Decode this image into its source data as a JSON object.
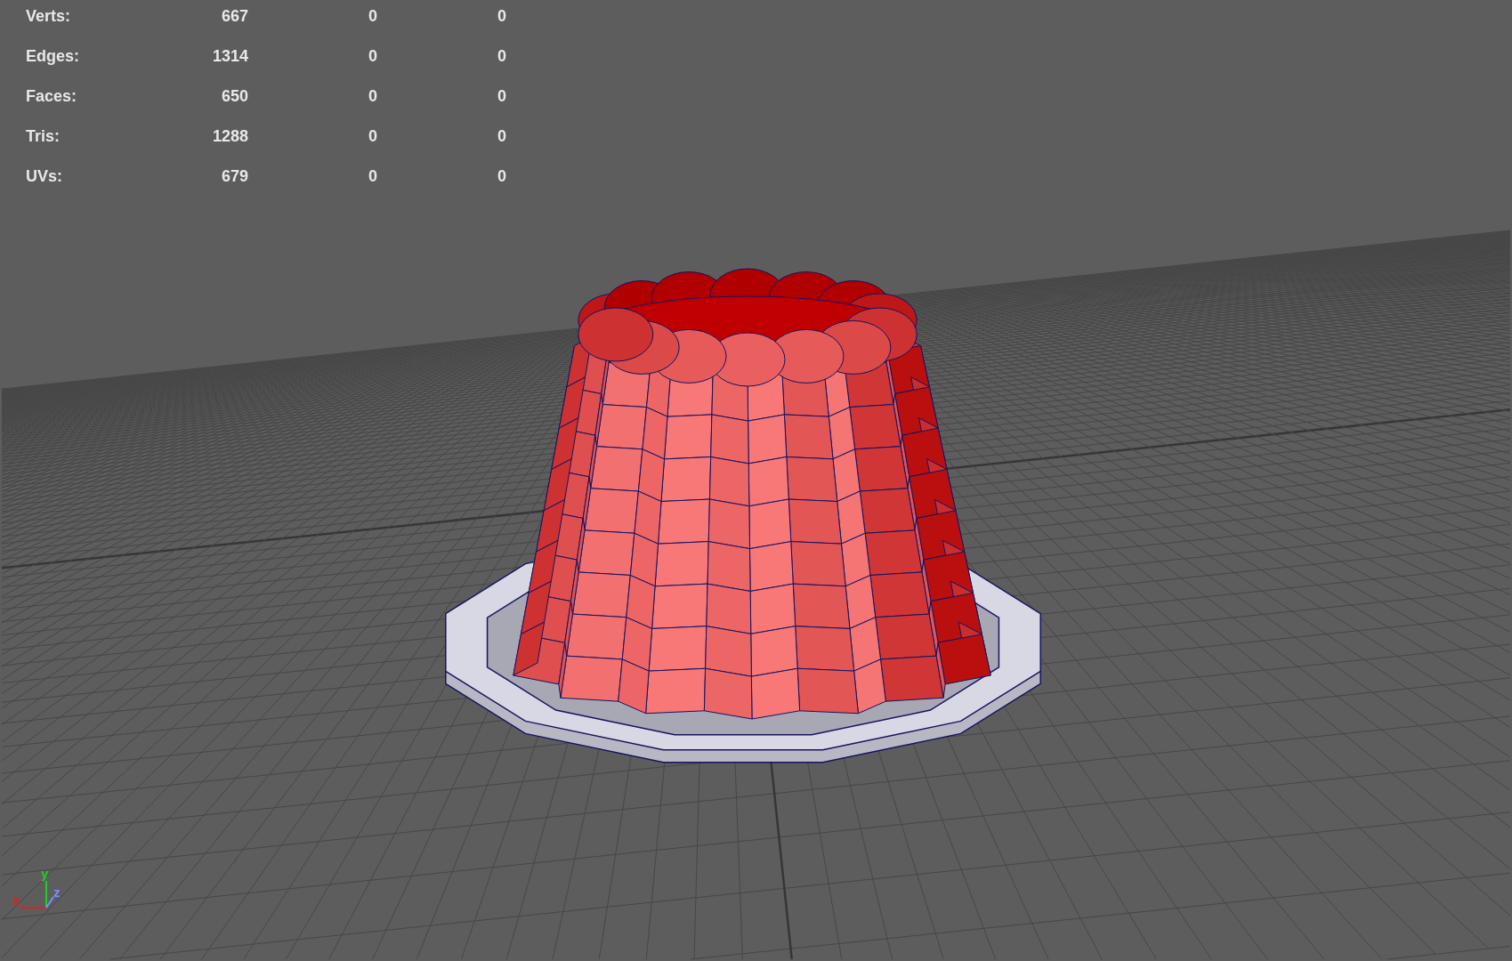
{
  "stats": [
    {
      "label": "Verts:",
      "values": [
        "667",
        "0",
        "0"
      ]
    },
    {
      "label": "Edges:",
      "values": [
        "1314",
        "0",
        "0"
      ]
    },
    {
      "label": "Faces:",
      "values": [
        "650",
        "0",
        "0"
      ]
    },
    {
      "label": "Tris:",
      "values": [
        "1288",
        "0",
        "0"
      ]
    },
    {
      "label": "UVs:",
      "values": [
        "679",
        "0",
        "0"
      ]
    }
  ],
  "axes": [
    {
      "label": "x",
      "color": "#e02020"
    },
    {
      "label": "y",
      "color": "#20d020"
    },
    {
      "label": "z",
      "color": "#7890ff"
    }
  ]
}
